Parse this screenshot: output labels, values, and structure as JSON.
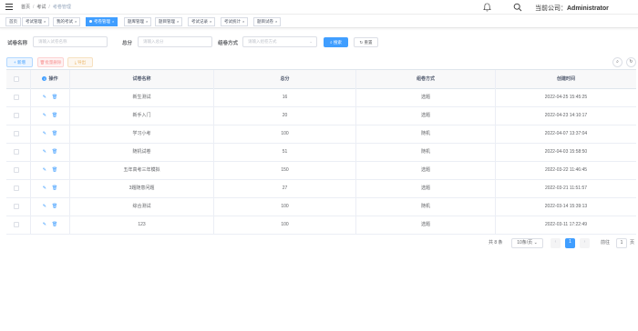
{
  "header": {
    "breadcrumb": [
      "首页",
      "考试",
      "考卷管理"
    ],
    "company_prefix": "当前公司：",
    "company_name": "Administrator"
  },
  "tags": [
    {
      "label": "首页",
      "active": false,
      "closable": false
    },
    {
      "label": "考试管理",
      "active": false,
      "closable": true
    },
    {
      "label": "我的考试",
      "active": false,
      "closable": true
    },
    {
      "label": "考卷管理",
      "active": true,
      "closable": true
    },
    {
      "label": "题库管理",
      "active": false,
      "closable": true
    },
    {
      "label": "题目管理",
      "active": false,
      "closable": true
    },
    {
      "label": "考试记录",
      "active": false,
      "closable": true
    },
    {
      "label": "考试统计",
      "active": false,
      "closable": true
    },
    {
      "label": "题目试卷",
      "active": false,
      "closable": true
    }
  ],
  "search": {
    "name_label": "试卷名称",
    "name_placeholder": "请输入试卷名称",
    "score_label": "总分",
    "score_placeholder": "请输入总分",
    "mode_label": "组卷方式",
    "mode_placeholder": "请输入组卷方式",
    "search_button": "搜索",
    "reset_button": "重置"
  },
  "toolbar": {
    "add": "新增",
    "delete": "批量删除",
    "export": "导出"
  },
  "table": {
    "columns": [
      "操作",
      "试卷名称",
      "总分",
      "组卷方式",
      "创建时间"
    ],
    "rows": [
      {
        "name": "新生测试",
        "score": "16",
        "mode": "选题",
        "created": "2022-04-25 15:45:25"
      },
      {
        "name": "新手入门",
        "score": "20",
        "mode": "选题",
        "created": "2022-04-23 14:10:17"
      },
      {
        "name": "学习小考",
        "score": "100",
        "mode": "随机",
        "created": "2022-04-07 13:37:04"
      },
      {
        "name": "随机试卷",
        "score": "51",
        "mode": "随机",
        "created": "2022-04-03 15:58:50"
      },
      {
        "name": "五年高考三年模拟",
        "score": "150",
        "mode": "选题",
        "created": "2022-03-22 11:46:45"
      },
      {
        "name": "3题随意问题",
        "score": "27",
        "mode": "选题",
        "created": "2022-03-21 11:51:57"
      },
      {
        "name": "综合测试",
        "score": "100",
        "mode": "随机",
        "created": "2022-03-14 15:39:13"
      },
      {
        "name": "123",
        "score": "100",
        "mode": "选题",
        "created": "2022-03-11 17:22:49"
      }
    ]
  },
  "pagination": {
    "total": "共 8 条",
    "page_size": "10条/页",
    "current_page": "1",
    "goto_prefix": "前往",
    "goto_value": "1",
    "goto_suffix": "页",
    "prev": "‹",
    "next": "›"
  },
  "colors": {
    "primary": "#409eff",
    "danger": "#f56c6c",
    "warning": "#e6a23c"
  }
}
